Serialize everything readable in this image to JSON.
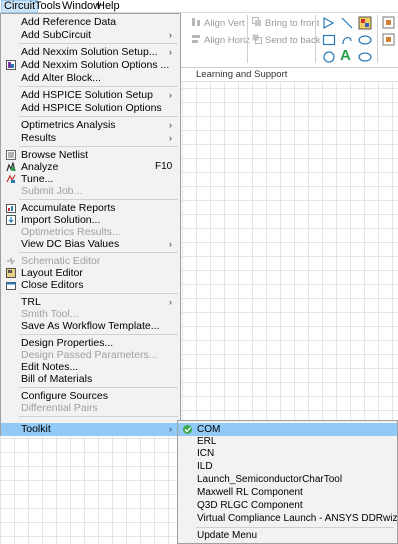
{
  "menubar": {
    "items": [
      {
        "label": "Circuit"
      },
      {
        "label": "Tools"
      },
      {
        "label": "Window"
      },
      {
        "label": "Help"
      }
    ]
  },
  "toolbar": {
    "align_vert": "Align Vert",
    "align_horiz": "Align Horiz",
    "bring_to_front": "Bring to front",
    "send_to_back": "Send to back",
    "text_tool_glyph": "A",
    "ribbon_label": "Learning and Support"
  },
  "menu": {
    "add_reference_data": "Add Reference Data",
    "add_subcircuit": "Add SubCircuit",
    "add_nexxim_solution_setup": "Add Nexxim Solution Setup...",
    "add_nexxim_solution_options": "Add Nexxim Solution Options ...",
    "add_alter_block": "Add Alter Block...",
    "add_hspice_solution_setup": "Add HSPICE Solution Setup",
    "add_hspice_solution_options": "Add HSPICE Solution Options",
    "optimetrics_analysis": "Optimetrics Analysis",
    "results": "Results",
    "browse_netlist": "Browse Netlist",
    "analyze": "Analyze",
    "analyze_shortcut": "F10",
    "tune": "Tune...",
    "submit_job": "Submit Job...",
    "accumulate_reports": "Accumulate Reports",
    "import_solution": "Import Solution...",
    "optimetrics_results": "Optimetrics Results...",
    "view_dc_bias_values": "View DC Bias Values",
    "schematic_editor": "Schematic Editor",
    "layout_editor": "Layout Editor",
    "close_editors": "Close Editors",
    "trl": "TRL",
    "smith_tool": "Smith Tool...",
    "save_as_workflow_template": "Save As Workflow Template...",
    "design_properties": "Design Properties...",
    "design_passed_parameters": "Design Passed Parameters...",
    "edit_notes": "Edit Notes...",
    "bill_of_materials": "Bill of Materials",
    "configure_sources": "Configure Sources",
    "differential_pairs": "Differential Pairs",
    "toolkit": "Toolkit",
    "submenu_arrow": "›"
  },
  "toolkit_submenu": {
    "items": [
      {
        "label": "COM"
      },
      {
        "label": "ERL"
      },
      {
        "label": "ICN"
      },
      {
        "label": "ILD"
      },
      {
        "label": "Launch_SemiconductorCharTool"
      },
      {
        "label": "Maxwell RL Component"
      },
      {
        "label": "Q3D RLGC Component"
      },
      {
        "label": "Virtual Compliance Launch - ANSYS DDRwizard"
      },
      {
        "label": "Update Menu"
      }
    ]
  },
  "colors": {
    "menu_bg": "#f2f2f2",
    "highlight": "#91c9f7",
    "disabled_text": "#a0a0a0",
    "menubar_active": "#cce4f7"
  }
}
